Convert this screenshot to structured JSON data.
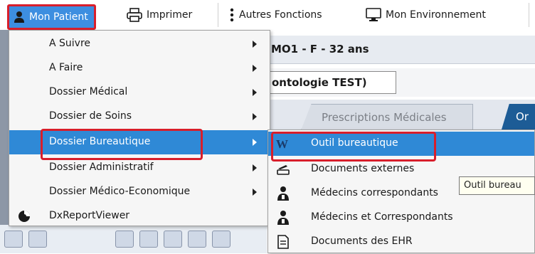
{
  "toolbar": {
    "mon_patient": "Mon Patient",
    "imprimer": "Imprimer",
    "autres_fonctions": "Autres Fonctions",
    "mon_environnement": "Mon Environnement"
  },
  "background": {
    "patient_banner": "MO1 - F - 32 ans",
    "service": "ontologie TEST)",
    "tab_prescriptions": "Prescriptions Médicales",
    "tab_active": "Or"
  },
  "menu": {
    "items": [
      {
        "label": "A Suivre"
      },
      {
        "label": "A Faire"
      },
      {
        "label": "Dossier Médical"
      },
      {
        "label": "Dossier de Soins"
      },
      {
        "label": "Dossier Bureautique"
      },
      {
        "label": "Dossier Administratif"
      },
      {
        "label": "Dossier Médico-Economique"
      },
      {
        "label": "DxReportViewer"
      }
    ]
  },
  "submenu": {
    "items": [
      {
        "label": "Outil bureautique",
        "icon": "word-icon"
      },
      {
        "label": "Documents externes",
        "icon": "scanner-icon"
      },
      {
        "label": "Médecins correspondants",
        "icon": "doctor-icon"
      },
      {
        "label": "Médecins et Correspondants",
        "icon": "doctors-icon"
      },
      {
        "label": "Documents des EHR",
        "icon": "document-icon"
      }
    ]
  },
  "tooltip": "Outil bureau",
  "colors": {
    "selection": "#2f89d6",
    "highlight_border": "#d81e2b",
    "active_tab": "#1d5c96"
  }
}
